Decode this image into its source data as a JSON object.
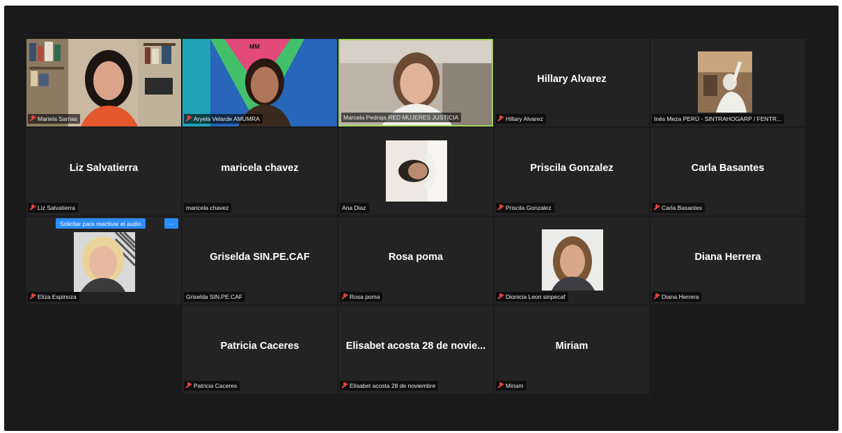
{
  "meeting": {
    "participants": [
      {
        "name": "Mariela Sarrias",
        "label": "Mariela Sarrias",
        "video": true,
        "muted": true
      },
      {
        "name": "Aryela Velarde AMUMRA",
        "label": "Aryela Velarde AMUMRA",
        "video": true,
        "muted": true
      },
      {
        "name": "Marcela Pedraja RED MUJERES JUSTICIA",
        "label": "Marcela Pedraja RED MUJERES JUSTICIA",
        "video": true,
        "muted": false,
        "active_speaker": true
      },
      {
        "name": "Hillary Alvarez",
        "label": "Hillary Alvarez",
        "video": false,
        "muted": true
      },
      {
        "name": "Inés Meza PERÚ - SINTRAHOGARP / FENTR...",
        "label": "Inés Meza PERÚ - SINTRAHOGARP / FENTR...",
        "video": true,
        "muted": false
      },
      {
        "name": "Liz Salvatierra",
        "label": "Liz Salvatierra",
        "video": false,
        "muted": true
      },
      {
        "name": "maricela chavez",
        "label": "maricela chavez",
        "video": false,
        "muted": false
      },
      {
        "name": "Ana Diaz",
        "label": "Ana Diaz",
        "video": true,
        "muted": false
      },
      {
        "name": "Priscila Gonzalez",
        "label": "Priscila Gonzalez",
        "video": false,
        "muted": true
      },
      {
        "name": "Carla Basantes",
        "label": "Carla Basantes",
        "video": false,
        "muted": true
      },
      {
        "name": "Eliza Espinoza",
        "label": "Eliza Espinoza",
        "video": true,
        "muted": true
      },
      {
        "name": "Griselda SIN.PE.CAF",
        "label": "Griselda SIN.PE.CAF",
        "video": false,
        "muted": false
      },
      {
        "name": "Rosa poma",
        "label": "Rosa poma",
        "video": false,
        "muted": true
      },
      {
        "name": "Dionicia Leon sinpecaf",
        "label": "Dionicia Leon sinpecaf",
        "video": true,
        "muted": true
      },
      {
        "name": "Diana Herrera",
        "label": "Diana Herrera",
        "video": false,
        "muted": true
      },
      {
        "name": "Patricia Caceres",
        "label": "Patricia Caceres",
        "video": false,
        "muted": true
      },
      {
        "name": "Elisabet acosta 28 de novie...",
        "label": "Elisabet acosta 28 de noviembre",
        "video": false,
        "muted": true
      },
      {
        "name": "Miriam",
        "label": "Miriam",
        "video": false,
        "muted": true
      }
    ],
    "unmute_request": {
      "text": "Solicitar para reactivar el audio",
      "more": "..."
    }
  },
  "colors": {
    "background": "#1a1a1a",
    "tile": "#232323",
    "active_border": "#9fd35a",
    "muted_icon": "#e0443e",
    "tooltip": "#2d8cff"
  },
  "icons": {
    "muted": "microphone-muted-icon",
    "more": "more-options-icon"
  }
}
